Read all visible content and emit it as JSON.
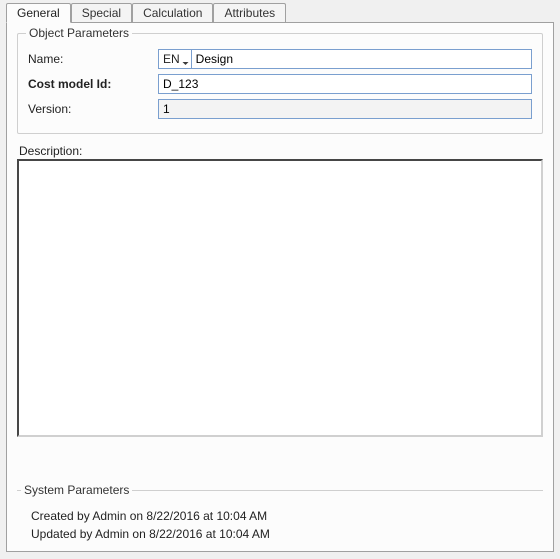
{
  "tabs": {
    "general": "General",
    "special": "Special",
    "calculation": "Calculation",
    "attributes": "Attributes"
  },
  "object_params": {
    "group_title": "Object Parameters",
    "name_label": "Name:",
    "lang_code": "EN",
    "name_value": "Design",
    "cost_model_label": "Cost model Id:",
    "cost_model_value": "D_123",
    "version_label": "Version:",
    "version_value": "1"
  },
  "description": {
    "label": "Description:",
    "value": ""
  },
  "system_params": {
    "group_title": "System Parameters",
    "created": "Created by Admin on 8/22/2016 at 10:04 AM",
    "updated": "Updated by Admin on 8/22/2016 at 10:04 AM"
  }
}
